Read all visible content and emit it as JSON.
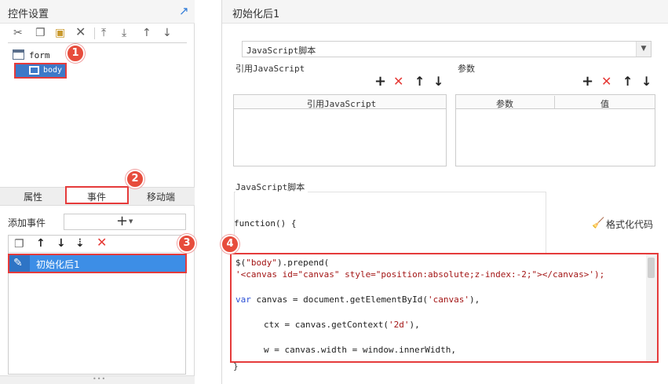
{
  "left": {
    "title": "控件设置",
    "tree": {
      "root": "form",
      "selected": "body"
    },
    "tabs": [
      "属性",
      "事件",
      "移动端"
    ],
    "add_event_label": "添加事件",
    "events": [
      "初始化后1"
    ]
  },
  "right": {
    "title": "初始化后1",
    "script_type": "JavaScript脚本",
    "ref_js_label": "引用JavaScript",
    "params_label": "参数",
    "ref_js_column": "引用JavaScript",
    "param_columns": [
      "参数",
      "值"
    ],
    "js_script_label": "JavaScript脚本",
    "function_header": "function() {",
    "format_label": "格式化代码",
    "code": {
      "l1a": "$(",
      "l1b": "\"body\"",
      "l1c": ").prepend(",
      "l2": "'<canvas id=\"canvas\" style=\"position:absolute;z-index:-2;\"></canvas>');",
      "l3kw": "var",
      "l3": " canvas = document.getElementById(",
      "l3s": "'canvas'",
      "l3e": "),",
      "l4": "ctx = canvas.getContext(",
      "l4s": "'2d'",
      "l4e": "),",
      "l5": "w = canvas.width = window.innerWidth,"
    },
    "close_brace": "}"
  },
  "badges": [
    "1",
    "2",
    "3",
    "4"
  ],
  "colors": {
    "accent": "#3d8ee6",
    "highlight": "#e53b3b",
    "delete": "#e53935"
  }
}
